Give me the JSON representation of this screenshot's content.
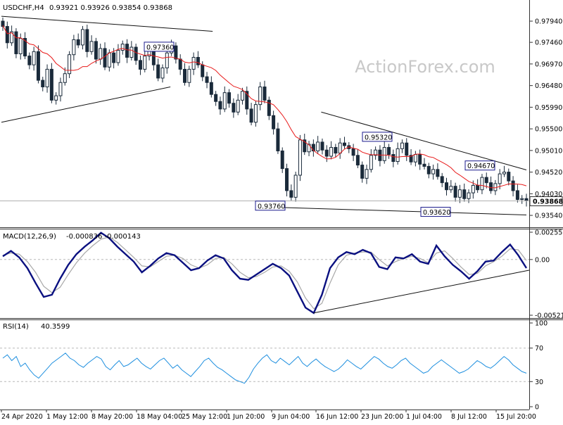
{
  "chart_data": [
    {
      "type": "candlestick",
      "header": {
        "symbol": "USDCHF,H4",
        "values": "0.93921 0.93926 0.93854 0.93868"
      },
      "watermark": "ActionForex.com",
      "price_axis": {
        "ticks": [
          "0.97940",
          "0.97460",
          "0.96970",
          "0.96480",
          "0.95990",
          "0.95500",
          "0.95010",
          "0.94520",
          "0.94030",
          "0.93540"
        ],
        "range": [
          0.9335,
          0.981
        ],
        "last_price": "0.93868",
        "last_price_value": 0.93868
      },
      "annotations": [
        {
          "label": "0.97360",
          "value": 0.9736
        },
        {
          "label": "0.95320",
          "value": 0.9532
        },
        {
          "label": "0.94670",
          "value": 0.9467
        },
        {
          "label": "0.93760",
          "value": 0.9376
        },
        {
          "label": "0.93620",
          "value": 0.9362
        }
      ],
      "trendlines": [
        {
          "from": [
            "2020-04-24",
            0.9565
          ],
          "to": [
            "2020-05-22",
            0.9645
          ]
        },
        {
          "from": [
            "2020-04-24",
            0.9805
          ],
          "to": [
            "2020-05-29",
            0.9771
          ]
        },
        {
          "from": [
            "2020-06-16",
            0.9588
          ],
          "to": [
            "2020-07-20",
            0.9457
          ]
        },
        {
          "from": [
            "2020-06-09",
            0.9372
          ],
          "to": [
            "2020-07-20",
            0.9355
          ]
        }
      ],
      "moving_average": {
        "color": "#e81a1a"
      },
      "candle_color": "#1a2a3a",
      "closes": [
        0.9782,
        0.9745,
        0.977,
        0.972,
        0.9755,
        0.9715,
        0.9695,
        0.9725,
        0.966,
        0.9645,
        0.9685,
        0.9615,
        0.9625,
        0.9655,
        0.9675,
        0.9718,
        0.9752,
        0.974,
        0.9775,
        0.9725,
        0.9748,
        0.9708,
        0.9732,
        0.969,
        0.9722,
        0.97,
        0.9728,
        0.9742,
        0.9712,
        0.9735,
        0.9705,
        0.9685,
        0.9715,
        0.9728,
        0.9695,
        0.9665,
        0.9688,
        0.9722,
        0.9738,
        0.9708,
        0.9685,
        0.9655,
        0.9685,
        0.9712,
        0.9695,
        0.9668,
        0.9655,
        0.9628,
        0.9612,
        0.9595,
        0.9632,
        0.9608,
        0.9588,
        0.9615,
        0.9635,
        0.9595,
        0.9565,
        0.9605,
        0.9645,
        0.9615,
        0.958,
        0.955,
        0.95,
        0.946,
        0.941,
        0.9395,
        0.9445,
        0.9525,
        0.9498,
        0.9515,
        0.95,
        0.952,
        0.9502,
        0.9488,
        0.9508,
        0.9495,
        0.9518,
        0.9512,
        0.9505,
        0.949,
        0.9468,
        0.9438,
        0.9458,
        0.949,
        0.9502,
        0.9478,
        0.9508,
        0.9492,
        0.9476,
        0.9505,
        0.9518,
        0.949,
        0.9475,
        0.9492,
        0.947,
        0.9465,
        0.9448,
        0.9458,
        0.9442,
        0.9428,
        0.9412,
        0.942,
        0.9395,
        0.9412,
        0.9392,
        0.9405,
        0.9422,
        0.9412,
        0.944,
        0.9428,
        0.941,
        0.9426,
        0.9448,
        0.9452,
        0.9432,
        0.941,
        0.939,
        0.9392,
        0.9387
      ],
      "dates": [
        "24 Apr 2020",
        "1 May 12:00",
        "8 May 20:00",
        "18 May 04:00",
        "25 May 12:00",
        "1 Jun 20:00",
        "9 Jun 04:00",
        "16 Jun 12:00",
        "23 Jun 20:00",
        "1 Jul 04:00",
        "8 Jul 12:00",
        "15 Jul 20:00"
      ]
    },
    {
      "type": "line",
      "indicator": "MACD(12,26,9)",
      "header_values": "-0.000836 -0.000143",
      "y_ticks": [
        "0.002553",
        "0.00",
        "-0.005212"
      ],
      "range": [
        -0.005212,
        0.002553
      ],
      "series": [
        {
          "color": "#0a1080",
          "values": [
            0.0003,
            0.0008,
            0.0002,
            -0.0008,
            -0.0022,
            -0.0035,
            -0.0033,
            -0.0018,
            -0.0005,
            0.0005,
            0.0012,
            0.0018,
            0.0025,
            0.002,
            0.0012,
            0.0005,
            -0.0002,
            -0.0012,
            -0.0006,
            0.0001,
            0.0006,
            0.0004,
            -0.0003,
            -0.001,
            -0.0008,
            -0.0001,
            0.0004,
            0.0001,
            -0.001,
            -0.0018,
            -0.0019,
            -0.0014,
            -0.0009,
            -0.0004,
            -0.0008,
            -0.0015,
            -0.003,
            -0.0045,
            -0.005,
            -0.0033,
            -0.0008,
            0.0002,
            0.0007,
            0.0005,
            0.0009,
            0.0006,
            -0.0007,
            -0.0009,
            0.0002,
            0.0001,
            0.0005,
            -0.0002,
            -0.0004,
            0.0013,
            0.0003,
            -0.0005,
            -0.0011,
            -0.0018,
            -0.0011,
            -0.0002,
            -0.0001,
            0.0007,
            0.0014,
            0.0004,
            -0.0008
          ]
        },
        {
          "color": "#a8a8a8",
          "values": [
            0.0004,
            0.0006,
            0.0005,
            -0.0002,
            -0.0012,
            -0.0025,
            -0.0031,
            -0.0026,
            -0.0014,
            -0.0003,
            0.0006,
            0.0013,
            0.0019,
            0.0021,
            0.0016,
            0.0009,
            0.0002,
            -0.0006,
            -0.0007,
            -0.0002,
            0.0003,
            0.0004,
            0.0001,
            -0.0005,
            -0.0008,
            -0.0005,
            0.0001,
            0.0002,
            -0.0004,
            -0.0012,
            -0.0017,
            -0.0016,
            -0.0012,
            -0.0007,
            -0.0006,
            -0.0011,
            -0.0021,
            -0.0036,
            -0.0046,
            -0.0041,
            -0.0022,
            -0.0005,
            0.0004,
            0.0006,
            0.0007,
            0.0007,
            0.0,
            -0.0006,
            -0.0002,
            0.0001,
            0.0003,
            0.0001,
            -0.0003,
            0.0006,
            0.0008,
            0.0001,
            -0.0007,
            -0.0014,
            -0.0013,
            -0.0006,
            -0.0002,
            0.0003,
            0.001,
            0.0009,
            -0.0001
          ]
        }
      ],
      "trendline": {
        "from": [
          38,
          -0.005
        ],
        "to": [
          64,
          -0.001
        ]
      }
    },
    {
      "type": "line",
      "indicator": "RSI(14)",
      "header_value": "40.3599",
      "y_ticks": [
        "100",
        "70",
        "30",
        "0"
      ],
      "levels": [
        70,
        30
      ],
      "range": [
        0,
        100
      ],
      "series": [
        {
          "color": "#1e8fdf",
          "values": [
            58,
            62,
            55,
            60,
            48,
            52,
            44,
            38,
            34,
            40,
            46,
            52,
            56,
            60,
            64,
            58,
            55,
            50,
            47,
            52,
            56,
            60,
            57,
            48,
            44,
            50,
            55,
            48,
            50,
            54,
            58,
            52,
            48,
            45,
            50,
            55,
            58,
            52,
            46,
            50,
            44,
            40,
            36,
            42,
            48,
            55,
            58,
            52,
            47,
            44,
            40,
            36,
            32,
            30,
            28,
            35,
            45,
            52,
            58,
            62,
            55,
            52,
            58,
            54,
            50,
            55,
            60,
            52,
            48,
            53,
            57,
            52,
            48,
            45,
            42,
            45,
            50,
            56,
            52,
            48,
            45,
            50,
            55,
            60,
            57,
            52,
            48,
            46,
            50,
            55,
            58,
            52,
            48,
            44,
            40,
            42,
            48,
            52,
            56,
            52,
            48,
            44,
            40,
            42,
            45,
            50,
            55,
            52,
            48,
            46,
            50,
            55,
            60,
            56,
            50,
            46,
            42,
            40
          ]
        }
      ]
    }
  ]
}
